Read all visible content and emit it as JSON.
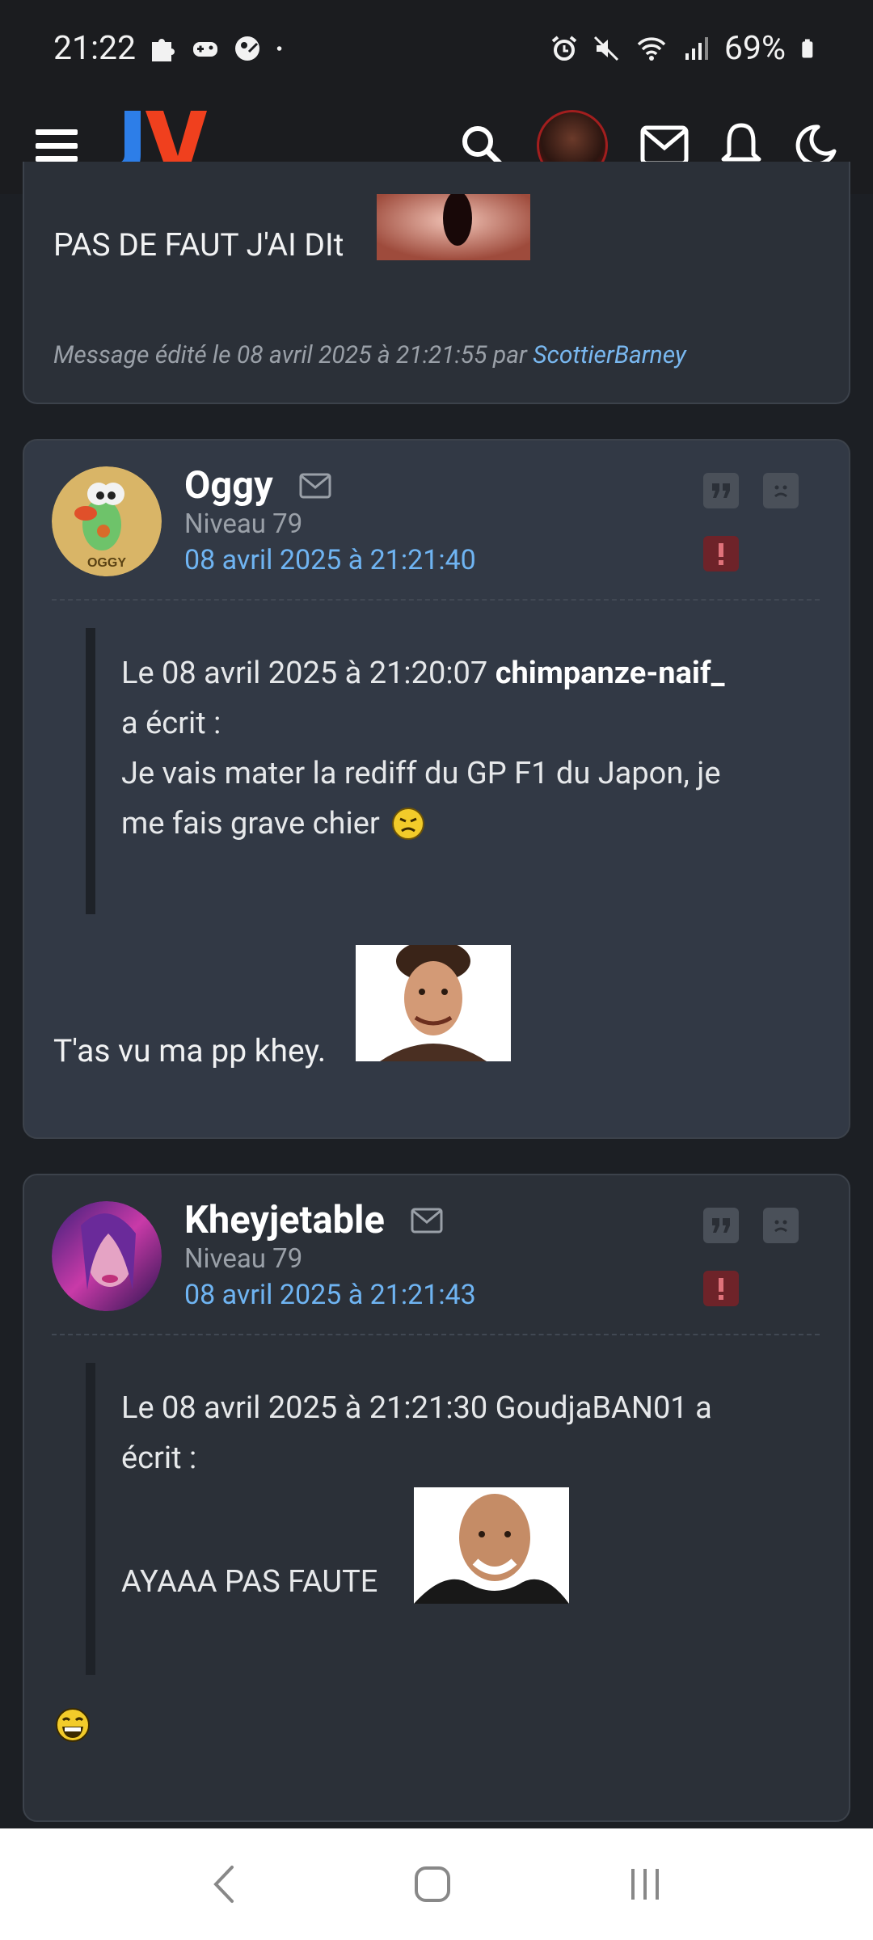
{
  "status_bar": {
    "time": "21:22",
    "battery": "69%"
  },
  "app_header": {
    "logo_text": "JV"
  },
  "posts": [
    {
      "message_text": "PAS DE FAUT J'AI DIt",
      "edit_note_prefix": "Message édité le 08 avril 2025 à 21:21:55 par",
      "edit_note_user": "ScottierBarney"
    },
    {
      "author": "Oggy",
      "level": "Niveau 79",
      "date": "08 avril 2025 à 21:21:40",
      "quote_header_prefix": "Le 08 avril 2025 à 21:20:07",
      "quote_author": "chimpanze-naif_",
      "quote_wrote": "a écrit :",
      "quote_body_line1": "Je vais mater la rediff du GP F1 du Japon, je",
      "quote_body_line2": "me fais grave chier",
      "message_text": "T'as vu ma pp khey."
    },
    {
      "author": "Kheyjetable",
      "level": "Niveau 79",
      "date": "08 avril 2025 à 21:21:43",
      "quote_line1": "Le 08 avril 2025 à 21:21:30 GoudjaBAN01 a",
      "quote_line2": "écrit :",
      "quote_body": "AYAAA PAS FAUTE"
    }
  ],
  "colors": {
    "accent_link": "#6fb4f2",
    "report": "#6e2329",
    "logo_blue": "#2d7ee8",
    "logo_red": "#f0401e"
  }
}
